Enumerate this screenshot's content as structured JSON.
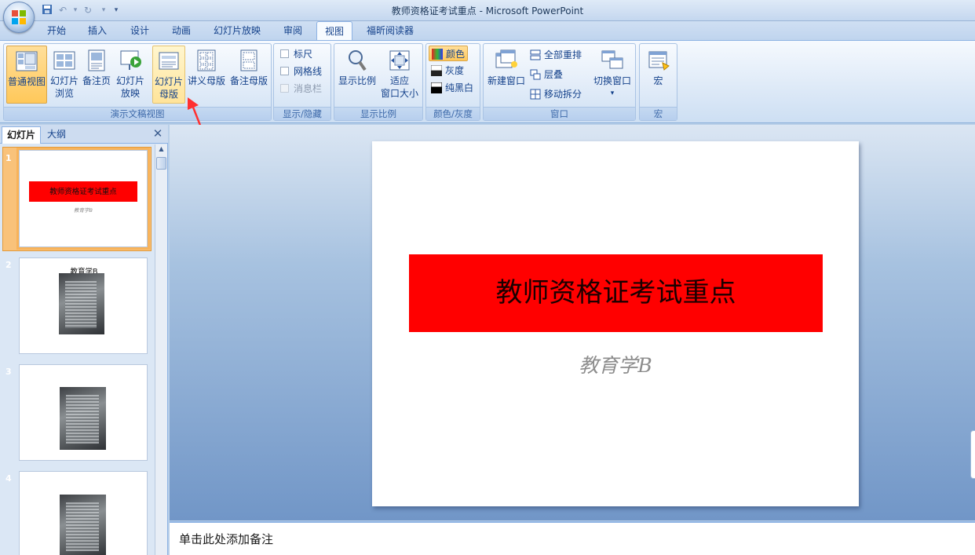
{
  "window": {
    "title": "教师资格证考试重点 - Microsoft PowerPoint"
  },
  "tabs": [
    "开始",
    "插入",
    "设计",
    "动画",
    "幻灯片放映",
    "审阅",
    "视图",
    "福昕阅读器"
  ],
  "active_tab": "视图",
  "ribbon": {
    "presentation_views": {
      "label": "演示文稿视图",
      "buttons": [
        {
          "line1": "普通视图",
          "line2": ""
        },
        {
          "line1": "幻灯片",
          "line2": "浏览"
        },
        {
          "line1": "备注页",
          "line2": ""
        },
        {
          "line1": "幻灯片",
          "line2": "放映"
        },
        {
          "line1": "幻灯片",
          "line2": "母版"
        },
        {
          "line1": "讲义母版",
          "line2": ""
        },
        {
          "line1": "备注母版",
          "line2": ""
        }
      ]
    },
    "show_hide": {
      "label": "显示/隐藏",
      "ruler": "标尺",
      "gridlines": "网格线",
      "message_bar": "消息栏"
    },
    "zoom": {
      "label": "显示比例",
      "zoom_button": "显示比例",
      "fit_line1": "适应",
      "fit_line2": "窗口大小"
    },
    "color": {
      "label": "颜色/灰度",
      "color": "颜色",
      "grayscale": "灰度",
      "bw": "纯黑白"
    },
    "window": {
      "label": "窗口",
      "new_window": "新建窗口",
      "arrange_all": "全部重排",
      "cascade": "层叠",
      "move_split": "移动拆分",
      "switch_windows": "切换窗口"
    },
    "macros": {
      "label": "宏",
      "macros_button": "宏"
    }
  },
  "pane": {
    "tab_slides": "幻灯片",
    "tab_outline": "大纲",
    "close": "✕",
    "slides": [
      {
        "num": "1",
        "title": "教师资格证考试重点",
        "subtitle": "教育学B"
      },
      {
        "num": "2",
        "title": "教育学B"
      },
      {
        "num": "3"
      },
      {
        "num": "4"
      }
    ]
  },
  "slide": {
    "title": "教师资格证考试重点",
    "subtitle": "教育学B"
  },
  "notes": {
    "placeholder": "单击此处添加备注"
  },
  "colors": {
    "slide_title_bg": "#ff0000",
    "selected_button": "#ffc85a",
    "annotation_arrow": "#ff3030"
  }
}
